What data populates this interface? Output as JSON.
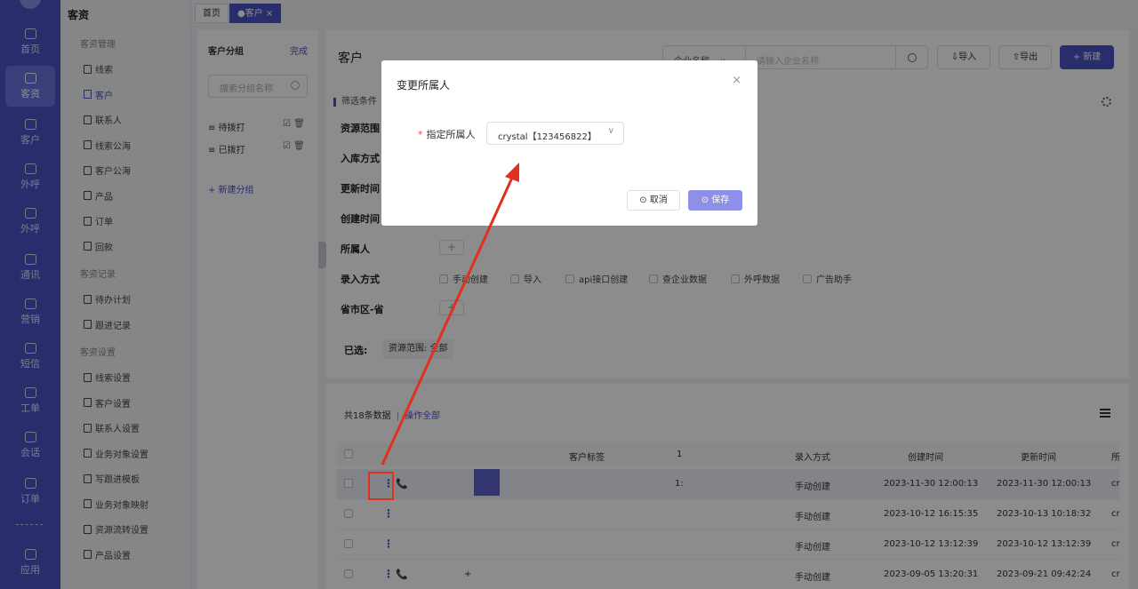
{
  "rail": {
    "items": [
      {
        "label": "首页",
        "icon": "home-icon"
      },
      {
        "label": "客资",
        "icon": "people-icon"
      },
      {
        "label": "客户",
        "icon": "user-icon"
      },
      {
        "label": "外呼",
        "icon": "phone-out-icon"
      },
      {
        "label": "外呼",
        "icon": "phone-call-icon"
      },
      {
        "label": "通讯",
        "icon": "calculator-icon"
      },
      {
        "label": "营销",
        "icon": "marketing-icon"
      },
      {
        "label": "短信",
        "icon": "sms-icon"
      },
      {
        "label": "工单",
        "icon": "clipboard-icon"
      },
      {
        "label": "会话",
        "icon": "chat-icon"
      },
      {
        "label": "订单",
        "icon": "order-icon"
      },
      {
        "label": "应用",
        "icon": "store-icon"
      }
    ],
    "active_index": 1
  },
  "menu": {
    "title": "客资",
    "sections": [
      {
        "label": "客资管理",
        "items": [
          "线索",
          "客户",
          "联系人",
          "线索公海",
          "客户公海",
          "产品",
          "订单",
          "回款"
        ]
      },
      {
        "label": "客资记录",
        "items": [
          "待办计划",
          "跟进记录"
        ]
      },
      {
        "label": "客资设置",
        "items": [
          "线索设置",
          "客户设置",
          "联系人设置",
          "业务对象设置",
          "写跟进模板",
          "业务对象映射",
          "资源流转设置",
          "产品设置"
        ]
      }
    ],
    "active": "客户"
  },
  "tabs": [
    {
      "label": "首页"
    },
    {
      "label": "●客户 ×"
    }
  ],
  "groups": {
    "title": "客户分组",
    "done": "完成",
    "search_placeholder": "搜索分组名称",
    "items": [
      "待拨打",
      "已拨打"
    ],
    "item_prefix": "≡",
    "actions": "☑ 🗑",
    "add": "+ 新建分组"
  },
  "header": {
    "title": "客户",
    "select_value": "企业名称",
    "select_chevron": "∨",
    "search_placeholder": "请输入企业名称",
    "import": "⇩导入",
    "export": "⇧导出",
    "new": "+ 新建"
  },
  "filters": {
    "label": "筛选条件",
    "rows": [
      "资源范围",
      "入库方式",
      "更新时间",
      "创建时间",
      "所属人",
      "录入方式",
      "省市区-省"
    ],
    "plus": "+",
    "entry_methods": [
      "手动创建",
      "导入",
      "api接口创建",
      "查企业数据",
      "外呼数据",
      "广告助手"
    ],
    "selected_label": "已选:",
    "selected_tag": "资源范围: 全部"
  },
  "table": {
    "count": "共18条数据",
    "separator": "|",
    "bulk": "操作全部",
    "columns": [
      "客户标签",
      "1",
      "录入方式",
      "创建时间",
      "更新时间",
      "所"
    ],
    "rows": [
      {
        "kebab": "⋮",
        "phone": "📞",
        "col1": "1:",
        "method": "手动创建",
        "created": "2023-11-30 12:00:13",
        "updated": "2023-11-30 12:00:13",
        "owner": "cr",
        "hover": true
      },
      {
        "kebab": "⋮",
        "phone": "",
        "col1": "",
        "method": "手动创建",
        "created": "2023-10-12 16:15:35",
        "updated": "2023-10-13 10:18:32",
        "owner": "cr",
        "hover": false
      },
      {
        "kebab": "⋮",
        "phone": "",
        "col1": "",
        "method": "手动创建",
        "created": "2023-10-12 13:12:39",
        "updated": "2023-10-12 13:12:39",
        "owner": "cr",
        "hover": false
      },
      {
        "kebab": "⋮",
        "phone": "📞",
        "col1": "+",
        "method": "手动创建",
        "created": "2023-09-05 13:20:31",
        "updated": "2023-09-21 09:42:24",
        "owner": "cr",
        "hover": false
      }
    ]
  },
  "modal": {
    "title": "变更所属人",
    "close": "×",
    "required_mark": "*",
    "field_label": "指定所属人",
    "field_value": "crystal【123456822】",
    "field_chevron": "∨",
    "cancel": "⊙ 取消",
    "save": "⊙ 保存"
  },
  "colors": {
    "brand": "#4b52c4",
    "annotation": "#e0301e"
  }
}
